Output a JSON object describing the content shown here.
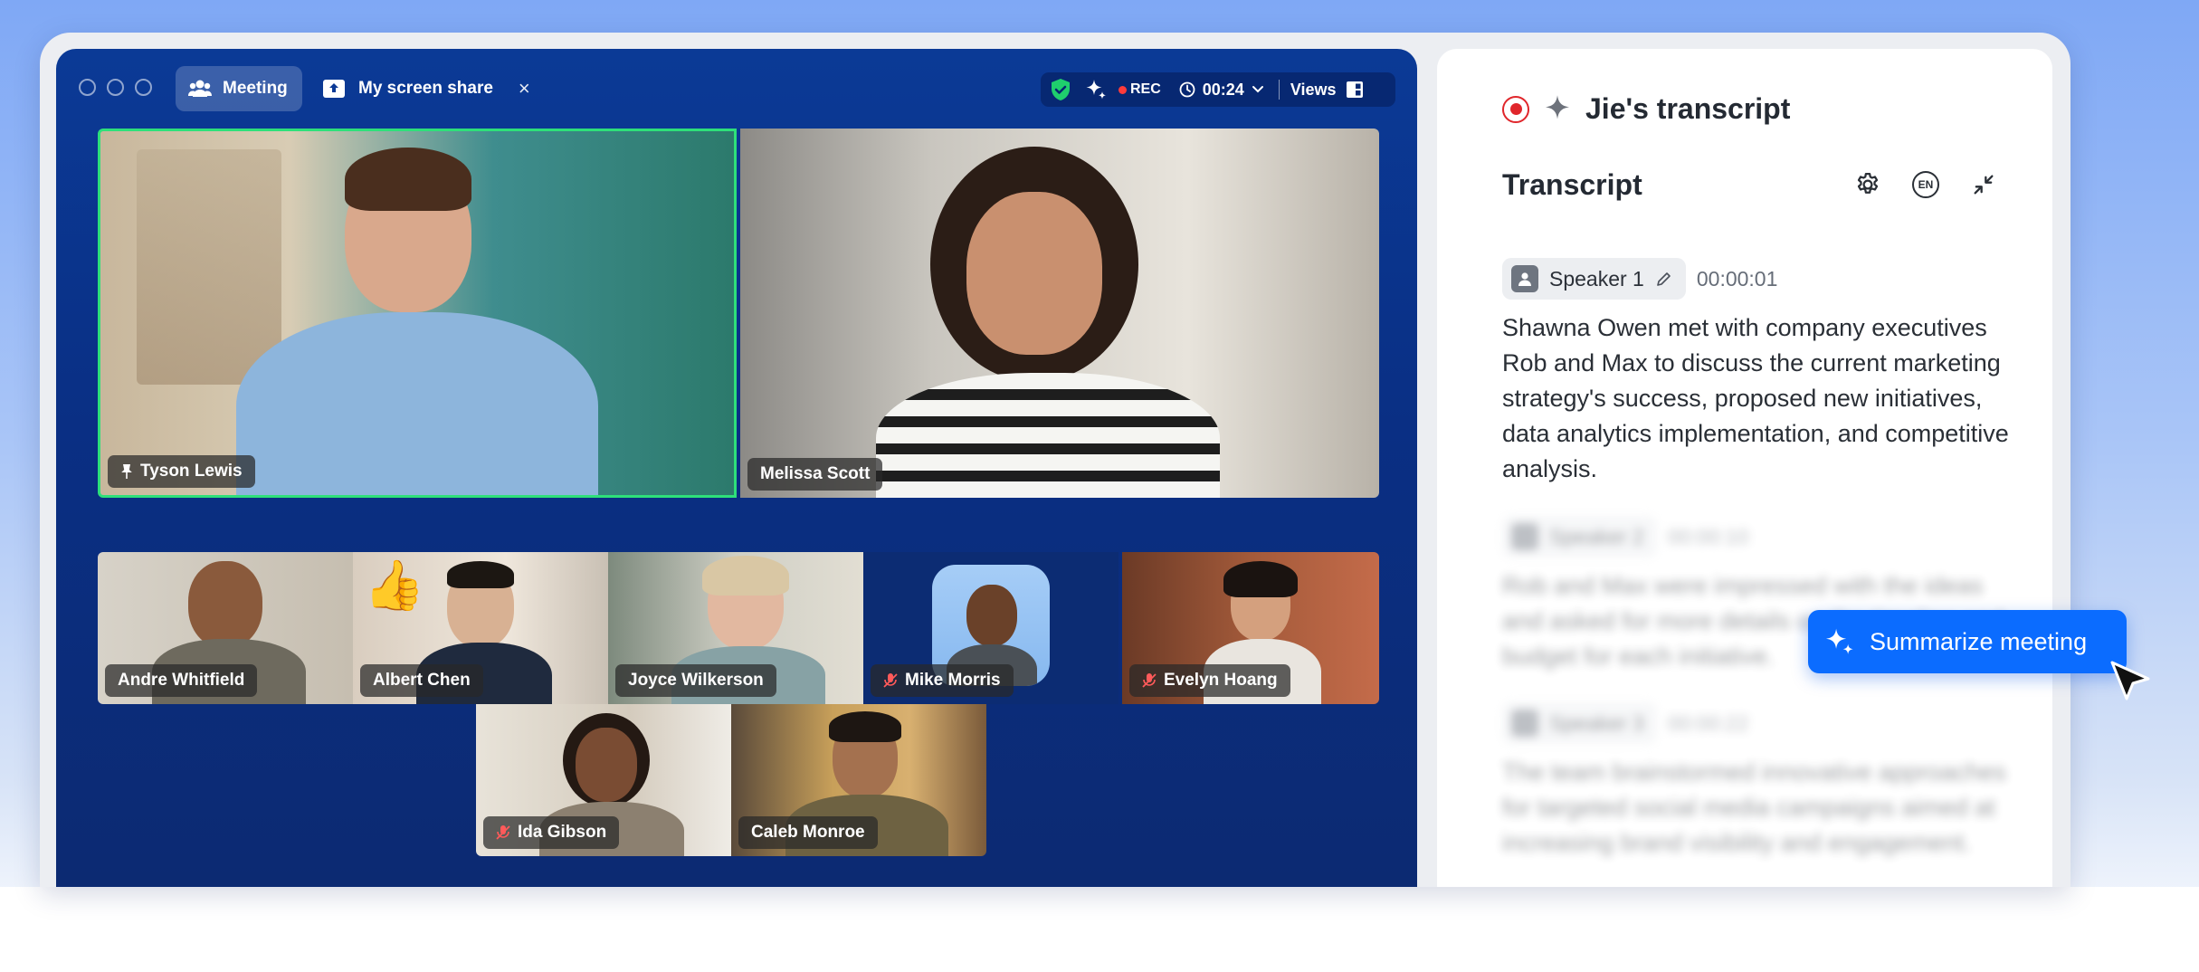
{
  "meeting": {
    "tab_meeting": "Meeting",
    "tab_share": "My screen share",
    "close_glyph": "×",
    "status": {
      "rec_label": "REC",
      "timer": "00:24",
      "views_label": "Views"
    },
    "tiles": [
      {
        "name": "Tyson Lewis",
        "pinned": true,
        "muted": false,
        "active_speaker": true
      },
      {
        "name": "Melissa Scott",
        "pinned": false,
        "muted": false
      },
      {
        "name": "Andre Whitfield",
        "muted": false
      },
      {
        "name": "Albert Chen",
        "muted": false,
        "reaction": "👍"
      },
      {
        "name": "Joyce Wilkerson",
        "muted": false
      },
      {
        "name": "Mike Morris",
        "muted": true
      },
      {
        "name": "Evelyn Hoang",
        "muted": true
      },
      {
        "name": "Ida Gibson",
        "muted": true
      },
      {
        "name": "Caleb Monroe",
        "muted": false
      }
    ],
    "colors": {
      "active_border": "#2ee07a",
      "muted_mic": "#ff5a5a",
      "shield": "#1fcf6d"
    }
  },
  "transcript": {
    "owner_title": "Jie's transcript",
    "section_title": "Transcript",
    "language_badge": "EN",
    "entries": [
      {
        "speaker": "Speaker 1",
        "time": "00:00:01",
        "text": "Shawna Owen met with company executives Rob and Max to discuss the current marketing strategy's success, proposed new initiatives, data analytics implementation, and competitive analysis."
      },
      {
        "speaker": "Speaker 2",
        "time": "00:00:10",
        "text": "Rob and Max were impressed with the ideas and asked for more details on the timeline and budget for each initiative."
      },
      {
        "speaker": "Speaker 3",
        "time": "00:00:22",
        "text": "The team brainstormed innovative approaches for targeted social media campaigns aimed at increasing brand visibility and engagement."
      }
    ]
  },
  "summarize_button": "Summarize meeting",
  "icons": [
    "people-icon",
    "screen-share-icon",
    "close-icon",
    "shield-check-icon",
    "sparkle-icon",
    "clock-icon",
    "chevron-down-icon",
    "layout-icon",
    "pin-icon",
    "mic-off-icon",
    "record-icon",
    "gear-icon",
    "language-icon",
    "collapse-icon",
    "person-icon",
    "pencil-icon",
    "cursor-icon"
  ]
}
